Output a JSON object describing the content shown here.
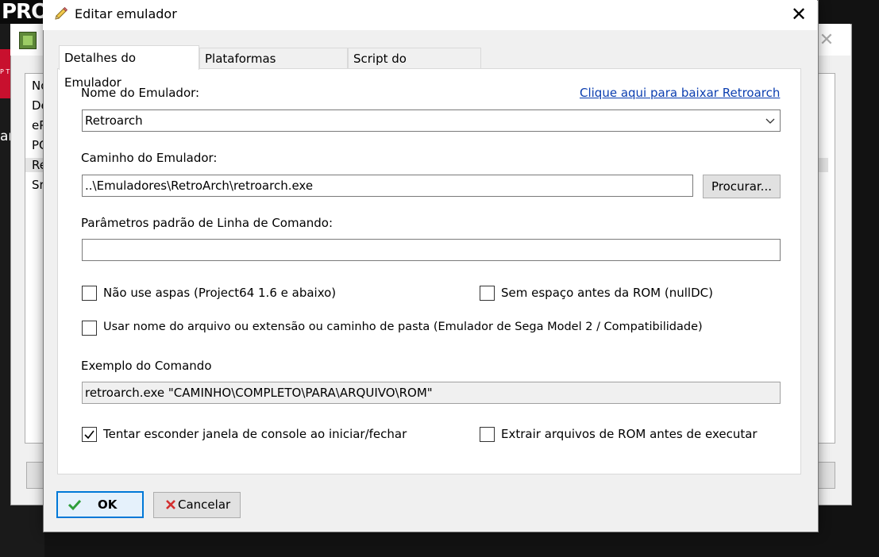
{
  "background": {
    "logo_text": "PRO",
    "red_tag_text": "P T",
    "side_text": "ar",
    "list_items": [
      "No",
      "De",
      "eP",
      "PC",
      "Re",
      "Sr"
    ]
  },
  "dialog": {
    "title": "Editar emulador",
    "close_label": "✕"
  },
  "tabs": [
    {
      "label": "Detalhes do Emulador",
      "active": true
    },
    {
      "label": "Plataformas Associadas",
      "active": false
    },
    {
      "label": "Script do AutoHotkey",
      "active": false
    }
  ],
  "form": {
    "name_label": "Nome do Emulador:",
    "download_link": "Clique aqui para baixar Retroarch",
    "name_value": "Retroarch",
    "path_label": "Caminho do Emulador:",
    "path_value": "..\\Emuladores\\RetroArch\\retroarch.exe",
    "browse_button": "Procurar...",
    "params_label": "Parâmetros padrão de Linha de Comando:",
    "params_value": "",
    "checkbox_no_quotes": {
      "label": "Não use aspas (Project64 1.6 e abaixo)",
      "checked": false
    },
    "checkbox_no_space": {
      "label": "Sem espaço antes da ROM (nullDC)",
      "checked": false
    },
    "checkbox_use_filename": {
      "label": "Usar nome do arquivo ou extensão ou caminho de pasta (Emulador de Sega Model 2 / Compatibilidade)",
      "checked": false
    },
    "example_label": "Exemplo do Comando",
    "example_value": "retroarch.exe \"CAMINHO\\COMPLETO\\PARA\\ARQUIVO\\ROM\"",
    "checkbox_hide_console": {
      "label": "Tentar esconder janela de console ao iniciar/fechar",
      "checked": true
    },
    "checkbox_extract_rom": {
      "label": "Extrair arquivos de ROM antes de executar",
      "checked": false
    }
  },
  "footer": {
    "ok_label": "OK",
    "cancel_label": "Cancelar"
  },
  "colors": {
    "link": "#0b3eb0",
    "ok_check": "#2e9e3a",
    "cancel_x": "#d32f2f",
    "ok_border": "#0078d7"
  }
}
